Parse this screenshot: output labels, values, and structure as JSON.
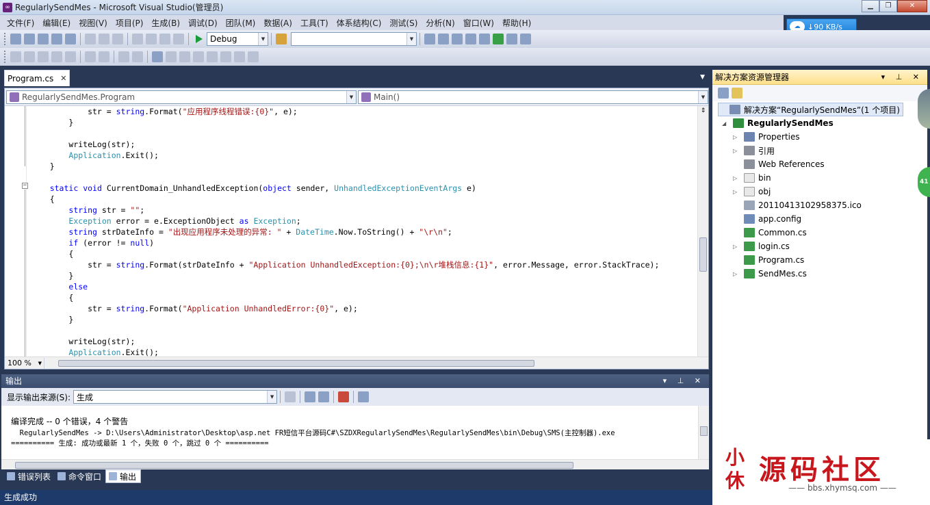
{
  "window": {
    "title": "RegularlySendMes - Microsoft Visual Studio(管理员)",
    "minimize": "▁",
    "maximize": "❐",
    "close": "✕"
  },
  "netspeed": {
    "label": "↓90 KB/s"
  },
  "menu": [
    "文件(F)",
    "编辑(E)",
    "视图(V)",
    "项目(P)",
    "生成(B)",
    "调试(D)",
    "团队(M)",
    "数据(A)",
    "工具(T)",
    "体系结构(C)",
    "测试(S)",
    "分析(N)",
    "窗口(W)",
    "帮助(H)"
  ],
  "toolbar": {
    "config": "Debug",
    "find": ""
  },
  "editor": {
    "tab_label": "Program.cs",
    "tab_close": "✕",
    "nav_class": "RegularlySendMes.Program",
    "nav_member": "Main()",
    "zoom": "100 %",
    "code_lines": [
      "            str = string.Format(\"应用程序线程错误:{0}\", e);",
      "        }",
      "",
      "        writeLog(str);",
      "        Application.Exit();",
      "    }",
      "",
      "    static void CurrentDomain_UnhandledException(object sender, UnhandledExceptionEventArgs e)",
      "    {",
      "        string str = \"\";",
      "        Exception error = e.ExceptionObject as Exception;",
      "        string strDateInfo = \"出现应用程序未处理的异常: \" + DateTime.Now.ToString() + \"\\r\\n\";",
      "        if (error != null)",
      "        {",
      "            str = string.Format(strDateInfo + \"Application UnhandledException:{0};\\n\\r堆栈信息:{1}\", error.Message, error.StackTrace);",
      "        }",
      "        else",
      "        {",
      "            str = string.Format(\"Application UnhandledError:{0}\", e);",
      "        }",
      "",
      "        writeLog(str);",
      "        Application.Exit();"
    ]
  },
  "output": {
    "title": "输出",
    "source_label": "显示输出来源(S):",
    "source_value": "生成",
    "lines": [
      "编译完成 -- 0 个错误，4 个警告",
      "  RegularlySendMes -> D:\\Users\\Administrator\\Desktop\\asp.net FR短信平台源码C#\\SZDXRegularlySendMes\\RegularlySendMes\\bin\\Debug\\SMS(主控制器).exe",
      "========== 生成: 成功或最新 1 个，失败 0 个，跳过 0 个 =========="
    ]
  },
  "bottom_tabs": [
    "错误列表",
    "命令窗口",
    "输出"
  ],
  "status": "生成成功",
  "solution_explorer": {
    "title": "解决方案资源管理器",
    "items": [
      {
        "label": "解决方案“RegularlySendMes”(1 个项目)",
        "expander": "",
        "icon": "#7a8db5"
      },
      {
        "label": "RegularlySendMes",
        "expander": "◢",
        "icon": "#2f8f3f"
      },
      {
        "label": "Properties",
        "expander": "▷",
        "icon": "#6d84b0"
      },
      {
        "label": "引用",
        "expander": "▷",
        "icon": "#8a8f99"
      },
      {
        "label": "Web References",
        "expander": "",
        "icon": "#8a8f99"
      },
      {
        "label": "bin",
        "expander": "▷",
        "icon": "#e8e8e8"
      },
      {
        "label": "obj",
        "expander": "▷",
        "icon": "#e8e8e8"
      },
      {
        "label": "20110413102958375.ico",
        "expander": "",
        "icon": "#9aa5b8"
      },
      {
        "label": "app.config",
        "expander": "",
        "icon": "#6f8bb8"
      },
      {
        "label": "Common.cs",
        "expander": "",
        "icon": "#3d9a4a"
      },
      {
        "label": "login.cs",
        "expander": "▷",
        "icon": "#3d9a4a"
      },
      {
        "label": "Program.cs",
        "expander": "",
        "icon": "#3d9a4a"
      },
      {
        "label": "SendMes.cs",
        "expander": "▷",
        "icon": "#3d9a4a"
      }
    ]
  },
  "side_badge": "41",
  "watermark": {
    "seal": "小休",
    "big": "源码社区",
    "site": "—— bbs.xhymsq.com ——"
  }
}
